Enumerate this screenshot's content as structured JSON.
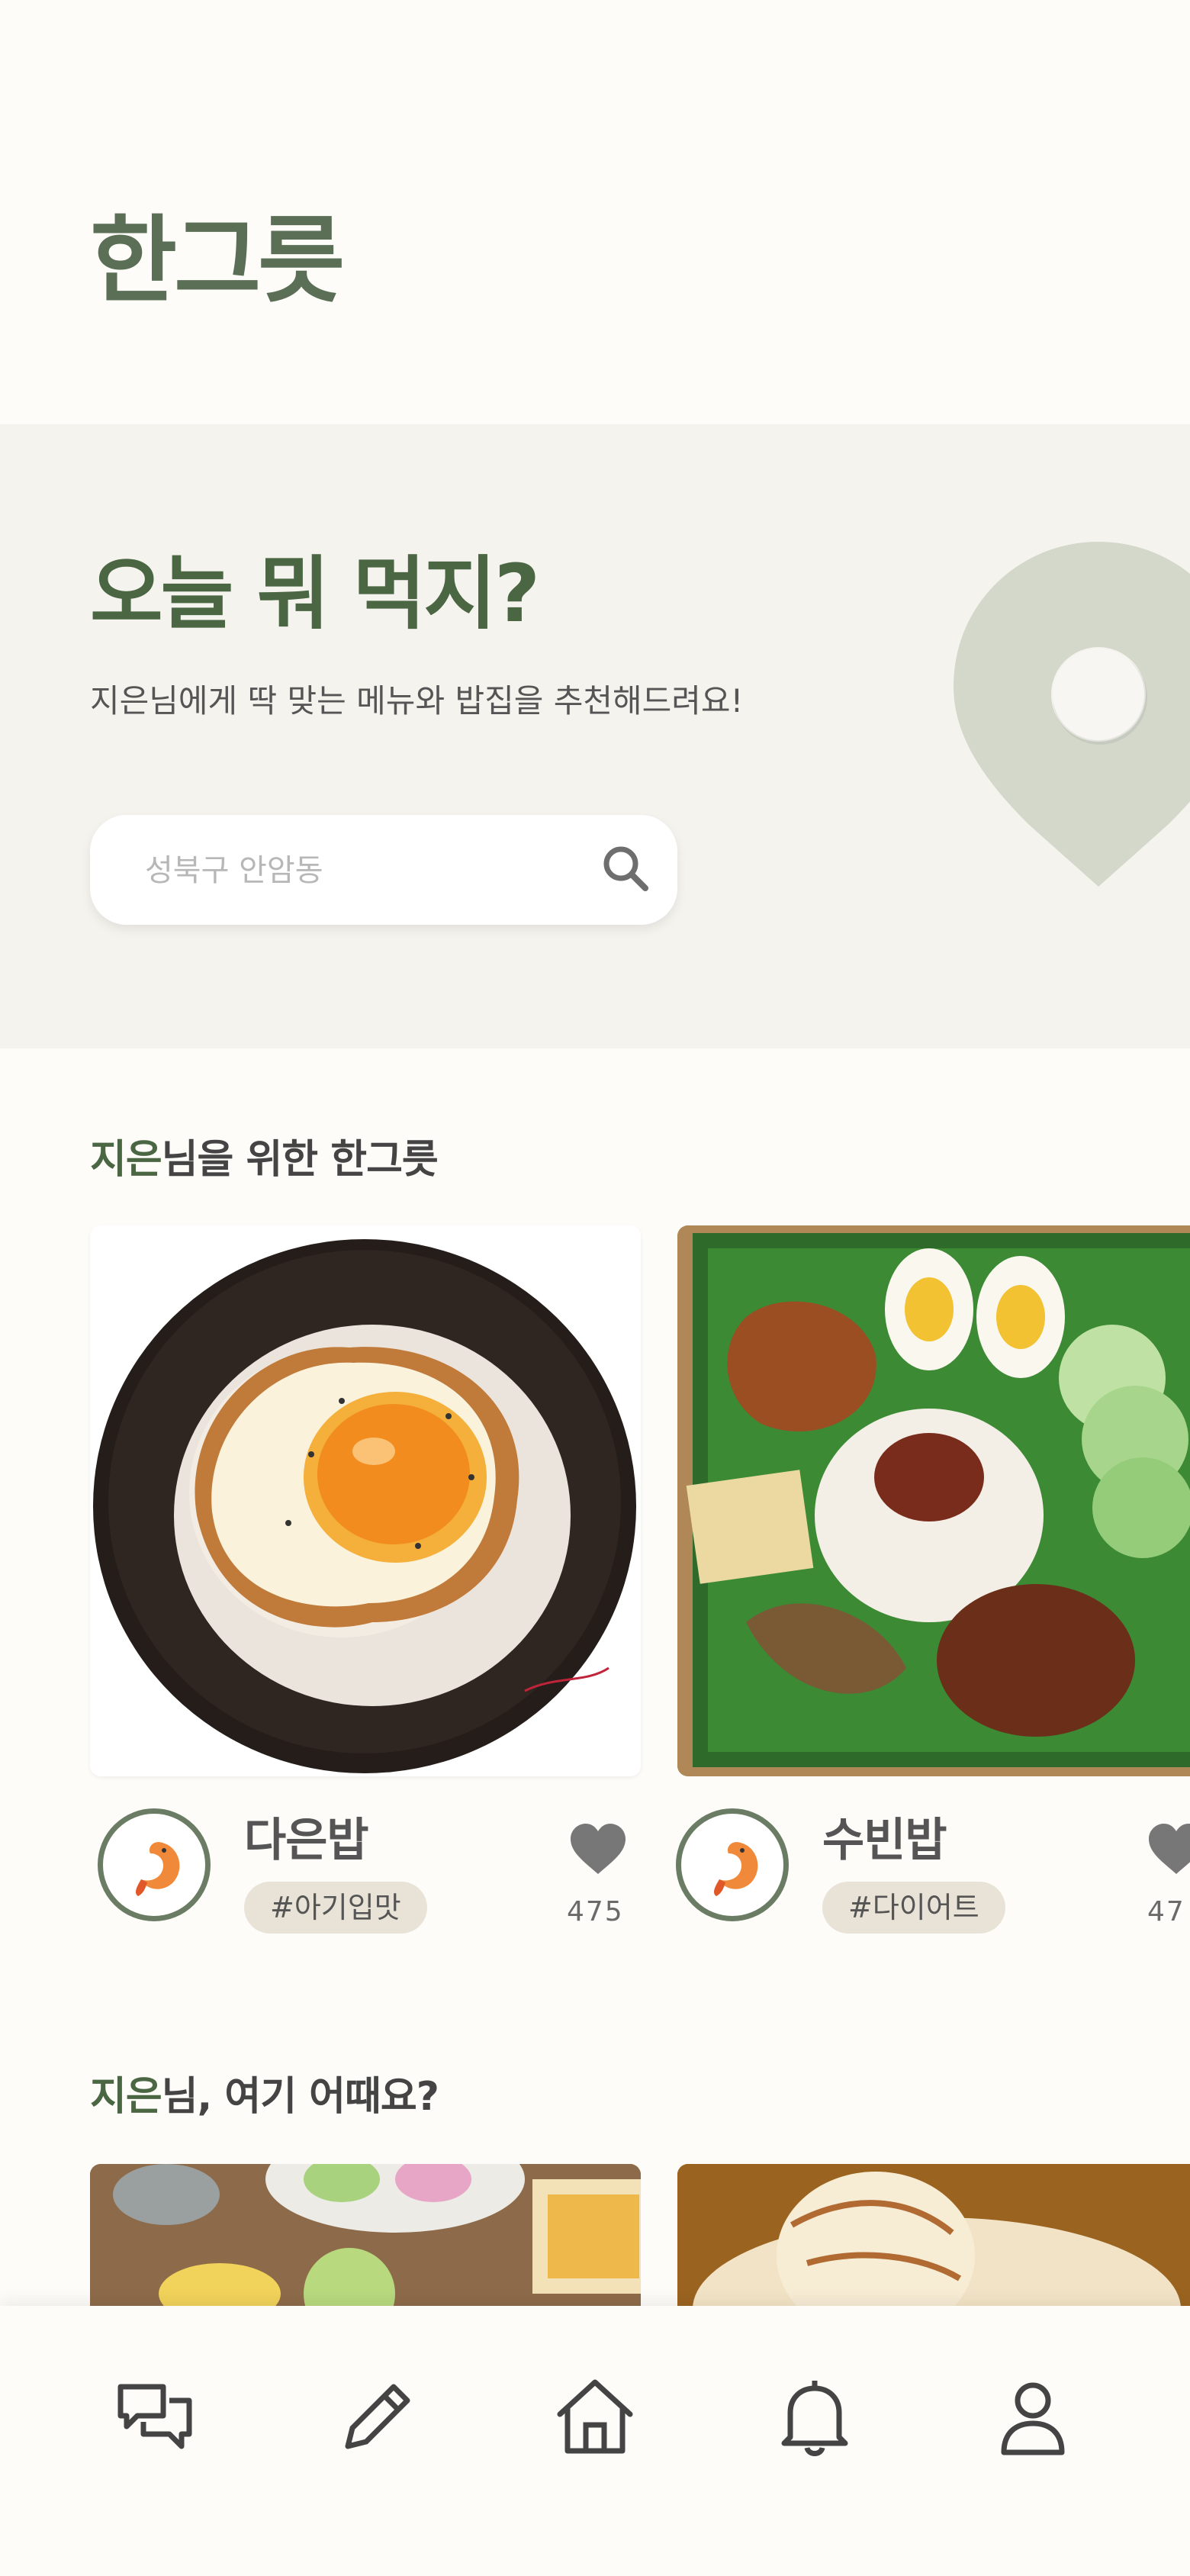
{
  "app": {
    "title": "한그릇"
  },
  "hero": {
    "title": "오늘 뭐 먹지?",
    "subtitle": "지은님에게 딱 맞는 메뉴와 밥집을 추천해드려요!",
    "search": {
      "placeholder": "성북구 안암동",
      "value": ""
    }
  },
  "section1": {
    "highlight": "지은",
    "title_rest": "님을 위한 한그릇",
    "cards": [
      {
        "name": "다은밥",
        "tag": "#아기입맛",
        "likes": "475",
        "avatar": "shrimp-icon"
      },
      {
        "name": "수빈밥",
        "tag": "#다이어트",
        "likes": "47",
        "avatar": "shrimp-icon"
      }
    ]
  },
  "section2": {
    "highlight": "지은",
    "title_rest": "님, 여기 어때요?"
  },
  "nav": {
    "items": [
      {
        "icon": "chat-icon"
      },
      {
        "icon": "pencil-icon"
      },
      {
        "icon": "home-icon"
      },
      {
        "icon": "bell-icon"
      },
      {
        "icon": "profile-icon"
      }
    ]
  },
  "colors": {
    "brand_green": "#4b6643",
    "title_green": "#5b6e56",
    "hero_bg": "#f5f3ee",
    "tag_bg": "#e8e3d6",
    "pin": "#d3d8cb"
  }
}
